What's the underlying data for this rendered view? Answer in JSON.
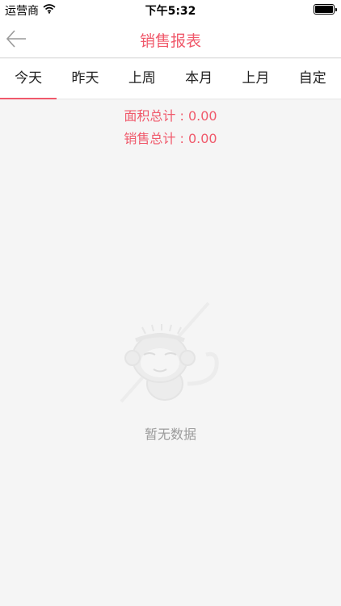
{
  "status_bar": {
    "carrier": "运营商",
    "time": "下午5:32"
  },
  "nav": {
    "title": "销售报表"
  },
  "tabs": [
    {
      "label": "今天"
    },
    {
      "label": "昨天"
    },
    {
      "label": "上周"
    },
    {
      "label": "本月"
    },
    {
      "label": "上月"
    },
    {
      "label": "自定"
    }
  ],
  "summary": {
    "area_total": "面积总计 : 0.00",
    "sales_total": "销售总计 : 0.00"
  },
  "empty_state": {
    "text": "暂无数据"
  },
  "colors": {
    "accent": "#f0596b"
  }
}
